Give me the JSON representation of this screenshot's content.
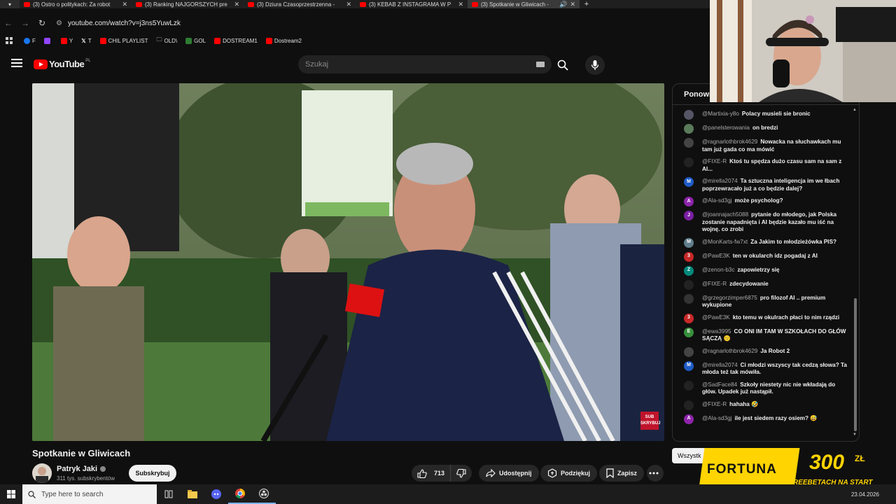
{
  "browser": {
    "tabs": [
      {
        "title": "(3) Ostro o politykach: Za robot"
      },
      {
        "title": "(3) Ranking NAJGORSZYCH pre"
      },
      {
        "title": "(3) Dziura Czasoprzestrzenna -"
      },
      {
        "title": "(3) KEBAB Z INSTAGRAMA W P"
      },
      {
        "title": "(3) Spotkanie w Gliwicach -"
      }
    ],
    "url": "youtube.com/watch?v=j3ns5YuwLzk",
    "bookmarks": [
      {
        "label": "F",
        "color": "#1877f2"
      },
      {
        "label": "",
        "color": "#9146ff"
      },
      {
        "label": "Y",
        "color": "#ff0000"
      },
      {
        "label": "T",
        "color": "#ffffff"
      },
      {
        "label": "CHIL PLAYLIST",
        "color": "#ff0000"
      },
      {
        "label": "OLD\\",
        "color": "#cccccc"
      },
      {
        "label": "GOL",
        "color": "#2e7d32"
      },
      {
        "label": "DOSTREAM1",
        "color": "#ff0000"
      },
      {
        "label": "Dostream2",
        "color": "#ff0000"
      }
    ]
  },
  "youtube": {
    "logo_text": "YouTube",
    "region": "PL",
    "search_placeholder": "Szukaj"
  },
  "video": {
    "title": "Spotkanie w Gliwicach",
    "channel": "Patryk Jaki",
    "subscribers": "311 tys. subskrybentów",
    "subscribe_label": "Subskrybuj",
    "likes": "713",
    "share_label": "Udostępnij",
    "thanks_label": "Podziękuj",
    "save_label": "Zapisz",
    "badge_text": "SUB SKRYBUJ"
  },
  "chat": {
    "header": "Ponown",
    "toggle_label": "Wszystk",
    "messages": [
      {
        "author": "@Martixia-y8o",
        "text": "Polacy musieli sie bronic",
        "avatar_color": "#556",
        "initial": ""
      },
      {
        "author": "@panelsterowania",
        "text": "on bredzi",
        "avatar_color": "#5a7a5a",
        "initial": ""
      },
      {
        "author": "@ragnarlothbrok4629",
        "text": "Nowacka na słuchawkach mu tam już gada co ma mówić",
        "avatar_color": "#444",
        "initial": ""
      },
      {
        "author": "@FIXE-R",
        "text": "Ktoś tu spędza dużo czasu sam na sam z AI...",
        "avatar_color": "#222",
        "initial": ""
      },
      {
        "author": "@mirella2074",
        "text": "Ta sztuczna inteligencja im we łbach poprzewracało już a co będzie dalej?",
        "avatar_color": "#1e5bc6",
        "initial": "M"
      },
      {
        "author": "@Ala-sd3gj",
        "text": "może psycholog?",
        "avatar_color": "#8e24aa",
        "initial": "A"
      },
      {
        "author": "@joannajach5088",
        "text": "pytanie do młodego, jak Polska zostanie napadnięta i AI będzie kazało mu iść na wojnę. co zrobi",
        "avatar_color": "#7b1fa2",
        "initial": "J"
      },
      {
        "author": "@MonKarts-fw7xt",
        "text": "Za Jakim to młodzieżówka PIS?",
        "avatar_color": "#607d8b",
        "initial": "M"
      },
      {
        "author": "@PawE3K",
        "text": "ten w okularch idz pogadaj z AI",
        "avatar_color": "#c62828",
        "initial": "3"
      },
      {
        "author": "@zenon-b3c",
        "text": "zapowietrzy się",
        "avatar_color": "#00897b",
        "initial": "Z"
      },
      {
        "author": "@FIXE-R",
        "text": "zdecydowanie",
        "avatar_color": "#222",
        "initial": ""
      },
      {
        "author": "@grzegorzimper6875",
        "text": "pro filozof AI .. premium wykupione",
        "avatar_color": "#333",
        "initial": ""
      },
      {
        "author": "@PawE3K",
        "text": "kto temu w okulrach płaci to nim rządzi",
        "avatar_color": "#c62828",
        "initial": "3"
      },
      {
        "author": "@ewa3995",
        "text": "CO ONI IM TAM W SZKOŁACH DO GŁÓW SĄCZĄ 😕",
        "avatar_color": "#388e3c",
        "initial": "E"
      },
      {
        "author": "@ragnarlothbrok4629",
        "text": "Ja Robot 2",
        "avatar_color": "#444",
        "initial": ""
      },
      {
        "author": "@mirella2074",
        "text": "Ci młodzi wszyscy tak cedzą słowa? Ta młoda też tak mówiła.",
        "avatar_color": "#1e5bc6",
        "initial": "M"
      },
      {
        "author": "@SadFace84",
        "text": "Szkoły niestety nic nie wkładają do głów. Upadek już nastąpił.",
        "avatar_color": "#222",
        "initial": ""
      },
      {
        "author": "@FIXE-R",
        "text": "hahaha 🤣",
        "avatar_color": "#222",
        "initial": ""
      },
      {
        "author": "@Ala-sd3gj",
        "text": "ile jest siedem razy osiem? 😅",
        "avatar_color": "#8e24aa",
        "initial": "A"
      }
    ]
  },
  "ad": {
    "brand": "FORTUNA",
    "amount": "300",
    "currency": "ZŁ",
    "tagline": "WE FREEBETACH NA START"
  },
  "taskbar": {
    "search_placeholder": "Type here to search",
    "date": "23.04.2026"
  }
}
